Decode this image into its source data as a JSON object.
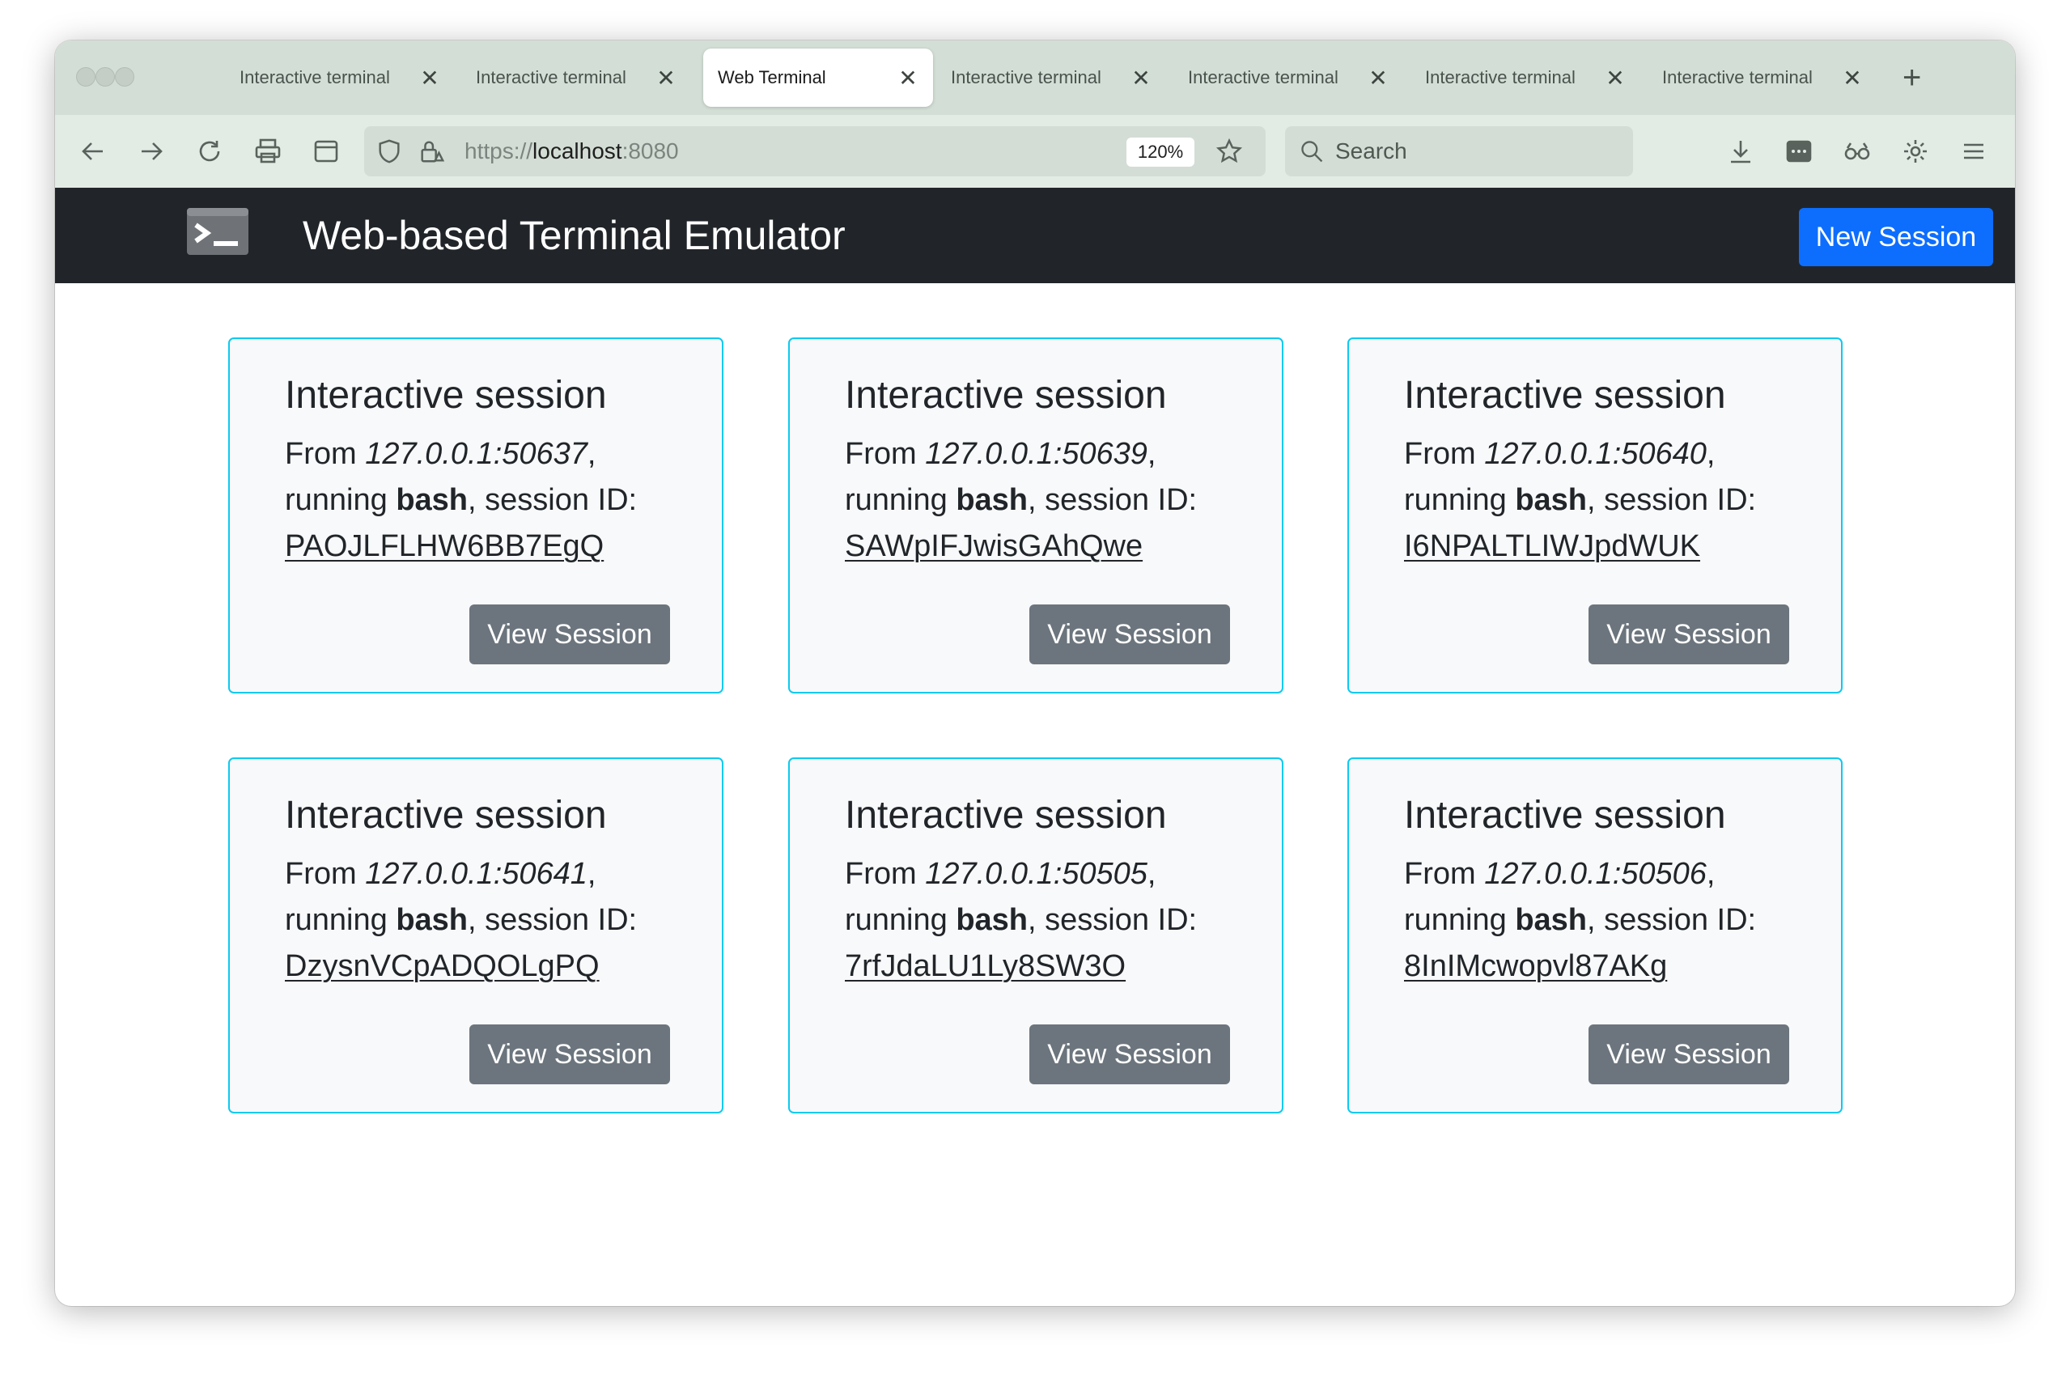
{
  "browser": {
    "tabs": [
      {
        "title": "Interactive terminal",
        "active": false
      },
      {
        "title": "Interactive terminal",
        "active": false
      },
      {
        "title": "Web Terminal",
        "active": true
      },
      {
        "title": "Interactive terminal",
        "active": false
      },
      {
        "title": "Interactive terminal",
        "active": false
      },
      {
        "title": "Interactive terminal",
        "active": false
      },
      {
        "title": "Interactive terminal",
        "active": false
      }
    ],
    "close_glyph": "✕",
    "new_tab_glyph": "+",
    "url": {
      "scheme": "https://",
      "host": "localhost",
      "port": ":8080"
    },
    "zoom": "120%",
    "search_placeholder": "Search"
  },
  "navbar": {
    "title": "Web-based Terminal Emulator",
    "new_session_label": "New Session"
  },
  "sessions": [
    {
      "title": "Interactive session",
      "from_label": "From",
      "address": "127.0.0.1:50637",
      "running_label": "running",
      "command": "bash",
      "sid_label": "session ID:",
      "session_id": "PAOJLFLHW6BB7EgQ",
      "button": "View Session"
    },
    {
      "title": "Interactive session",
      "from_label": "From",
      "address": "127.0.0.1:50639",
      "running_label": "running",
      "command": "bash",
      "sid_label": "session ID:",
      "session_id": "SAWpIFJwisGAhQwe",
      "button": "View Session"
    },
    {
      "title": "Interactive session",
      "from_label": "From",
      "address": "127.0.0.1:50640",
      "running_label": "running",
      "command": "bash",
      "sid_label": "session ID:",
      "session_id": "I6NPALTLIWJpdWUK",
      "button": "View Session"
    },
    {
      "title": "Interactive session",
      "from_label": "From",
      "address": "127.0.0.1:50641",
      "running_label": "running",
      "command": "bash",
      "sid_label": "session ID:",
      "session_id": "DzysnVCpADQOLgPQ",
      "button": "View Session"
    },
    {
      "title": "Interactive session",
      "from_label": "From",
      "address": "127.0.0.1:50505",
      "running_label": "running",
      "command": "bash",
      "sid_label": "session ID:",
      "session_id": "7rfJdaLU1Ly8SW3O",
      "button": "View Session"
    },
    {
      "title": "Interactive session",
      "from_label": "From",
      "address": "127.0.0.1:50506",
      "running_label": "running",
      "command": "bash",
      "sid_label": "session ID:",
      "session_id": "8InIMcwopvl87AKg",
      "button": "View Session"
    }
  ],
  "colors": {
    "navbar_bg": "#212529",
    "primary": "#0d6efd",
    "secondary": "#6c757d",
    "card_border": "#0dcaf0",
    "card_bg": "#f8f9fa",
    "tabstrip_bg": "#d3dfd6"
  },
  "icons": [
    "back-arrow-icon",
    "forward-arrow-icon",
    "reload-icon",
    "print-icon",
    "sidebar-icon",
    "shield-icon",
    "lock-warning-icon",
    "bookmark-star-icon",
    "search-icon",
    "download-icon",
    "extension-icon",
    "private-browsing-icon",
    "settings-gear-icon",
    "menu-icon",
    "terminal-logo-icon"
  ]
}
